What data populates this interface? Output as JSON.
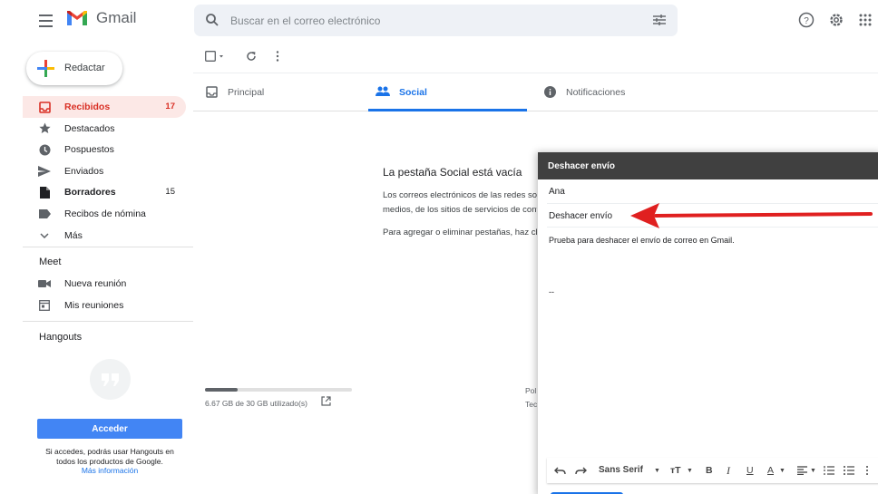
{
  "app": {
    "name": "Gmail"
  },
  "search": {
    "placeholder": "Buscar en el correo electrónico"
  },
  "compose_button": {
    "label": "Redactar"
  },
  "nav": [
    {
      "label": "Recibidos",
      "count": "17",
      "icon": "inbox-icon",
      "active": true
    },
    {
      "label": "Destacados",
      "count": "",
      "icon": "star-icon"
    },
    {
      "label": "Pospuestos",
      "count": "",
      "icon": "clock-icon"
    },
    {
      "label": "Enviados",
      "count": "",
      "icon": "send-icon"
    },
    {
      "label": "Borradores",
      "count": "15",
      "icon": "draft-icon",
      "bold": true
    },
    {
      "label": "Recibos de nómina",
      "count": "",
      "icon": "label-icon"
    },
    {
      "label": "Más",
      "count": "",
      "icon": "chevron-down-icon"
    }
  ],
  "meet": {
    "title": "Meet",
    "items": [
      {
        "label": "Nueva reunión",
        "icon": "video-icon"
      },
      {
        "label": "Mis reuniones",
        "icon": "calendar-icon"
      }
    ]
  },
  "hangouts": {
    "title": "Hangouts",
    "button": "Acceder",
    "text": "Si accedes, podrás usar Hangouts en todos los productos de Google.",
    "link": "Más información"
  },
  "tabs": [
    {
      "label": "Principal",
      "icon": "inbox-tab-icon"
    },
    {
      "label": "Social",
      "icon": "people-icon",
      "active": true
    },
    {
      "label": "Notificaciones",
      "icon": "info-icon"
    }
  ],
  "empty": {
    "title": "La pestaña Social está vacía",
    "body_line1": "Los correos electrónicos de las redes sociales,",
    "body_line2": "medios, de los sitios de servicios de contenido",
    "tip": "Para agregar o eliminar pestañas, haz clic en"
  },
  "storage": {
    "text": "6.67 GB de 30 GB utilizado(s)",
    "fraction": 0.22
  },
  "footer": {
    "pol": "Pol",
    "tec": "Tec"
  },
  "compose_window": {
    "title": "Deshacer envío",
    "to": "Ana",
    "subject": "Deshacer envío",
    "body": "Prueba para deshacer el envío de correo en Gmail.",
    "signature": "--",
    "font": "Sans Serif"
  },
  "colors": {
    "accent": "#1a73e8",
    "inbox_active": "#d93025",
    "arrow": "#e02020"
  }
}
